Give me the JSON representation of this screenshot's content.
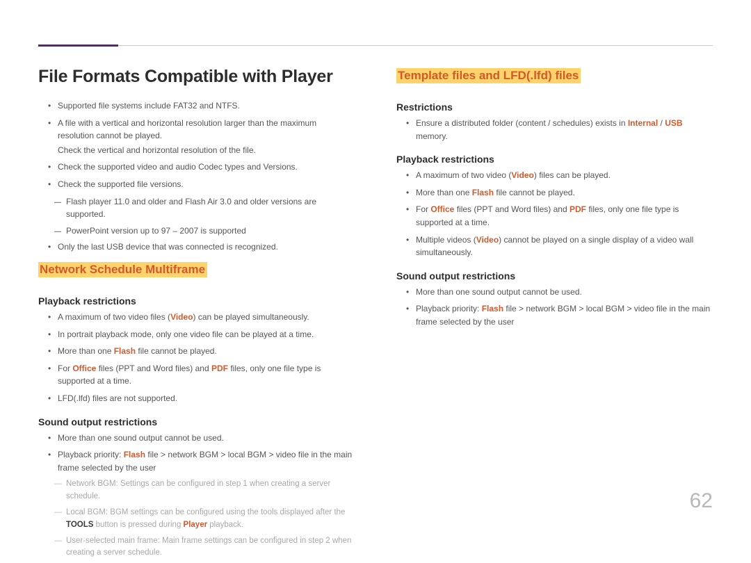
{
  "page_number": "62",
  "title": "File Formats Compatible with Player",
  "left": {
    "top_bullets": [
      {
        "parts": [
          "Supported file systems include FAT32 and NTFS."
        ]
      },
      {
        "parts": [
          "A file with a vertical and horizontal resolution larger than the maximum resolution cannot be played."
        ],
        "continuation": "Check the vertical and horizontal resolution of the file."
      },
      {
        "parts": [
          "Check the supported video and audio Codec types and Versions."
        ]
      },
      {
        "parts": [
          "Check the supported file versions."
        ],
        "dash": [
          "Flash player 11.0 and older and Flash Air 3.0 and older versions are supported.",
          "PowerPoint version up to 97 – 2007 is supported"
        ]
      },
      {
        "parts": [
          "Only the last USB device that was connected is recognized."
        ]
      }
    ],
    "section_heading": "Network Schedule Multiframe",
    "playback_hd": "Playback restrictions",
    "playback": [
      {
        "parts": [
          "A maximum of two video files (",
          {
            "o": "Video"
          },
          ") can be played simultaneously."
        ]
      },
      {
        "parts": [
          "In portrait playback mode, only one video file can be played at a time."
        ]
      },
      {
        "parts": [
          "More than one ",
          {
            "o": "Flash"
          },
          " file cannot be played."
        ]
      },
      {
        "parts": [
          "For ",
          {
            "o": "Office"
          },
          " files (PPT and Word files) and ",
          {
            "o": "PDF"
          },
          " files, only one file type is supported at a time."
        ]
      },
      {
        "parts": [
          "LFD(.lfd) files are not supported."
        ]
      }
    ],
    "sound_hd": "Sound output restrictions",
    "sound": [
      {
        "parts": [
          "More than one sound output cannot be used."
        ]
      },
      {
        "parts": [
          "Playback priority: ",
          {
            "o": "Flash"
          },
          " file > network BGM > local BGM > video file in the main frame selected by the user"
        ],
        "grey": [
          "Network BGM: Settings can be configured in step 1 when creating a server schedule.",
          {
            "parts": [
              "Local BGM: BGM settings can be configured using the tools displayed after the ",
              {
                "b": "TOOLS"
              },
              " button is pressed during ",
              {
                "o": "Player"
              },
              " playback."
            ]
          },
          "User-selected main frame: Main frame settings can be configured in step 2 when creating a server schedule."
        ]
      }
    ]
  },
  "right": {
    "section_heading": "Template files and LFD(.lfd) files",
    "restrictions_hd": "Restrictions",
    "restrictions": [
      {
        "parts": [
          "Ensure a distributed folder (content / schedules) exists in ",
          {
            "o": "Internal"
          },
          " / ",
          {
            "o": "USB"
          },
          " memory."
        ]
      }
    ],
    "playback_hd": "Playback restrictions",
    "playback": [
      {
        "parts": [
          "A maximum of two video (",
          {
            "o": "Video"
          },
          ") files can be played."
        ]
      },
      {
        "parts": [
          "More than one ",
          {
            "o": "Flash"
          },
          " file cannot be played."
        ]
      },
      {
        "parts": [
          "For ",
          {
            "o": "Office"
          },
          " files (PPT and Word files) and ",
          {
            "o": "PDF"
          },
          " files, only one file type is supported at a time."
        ]
      },
      {
        "parts": [
          "Multiple videos (",
          {
            "o": "Video"
          },
          ") cannot be played on a single display of a video wall simultaneously."
        ]
      }
    ],
    "sound_hd": "Sound output restrictions",
    "sound": [
      {
        "parts": [
          "More than one sound output cannot be used."
        ]
      },
      {
        "parts": [
          "Playback priority: ",
          {
            "o": "Flash"
          },
          " file > network BGM > local BGM > video file in the main frame selected by the user"
        ]
      }
    ]
  }
}
